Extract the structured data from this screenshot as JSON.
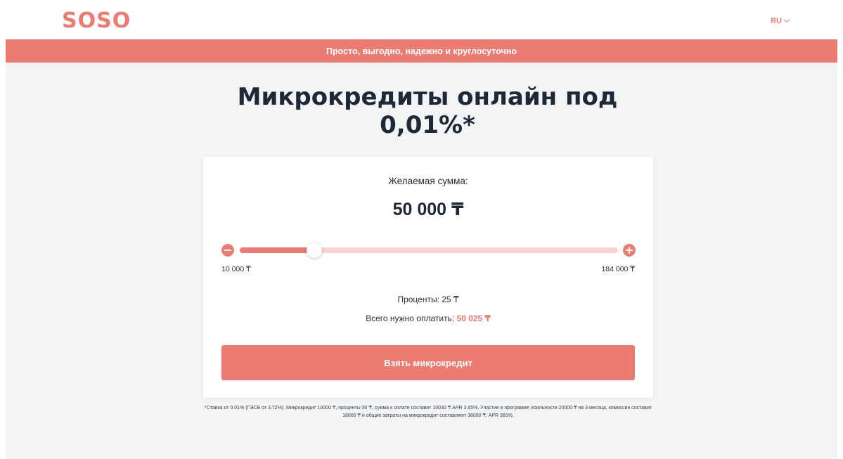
{
  "header": {
    "logo": "SOSO",
    "language": "RU"
  },
  "banner": {
    "text": "Просто, выгодно, надежно и круглосуточно"
  },
  "hero": {
    "title": "Микрокредиты онлайн под 0,01%*"
  },
  "calculator": {
    "amount_label": "Желаемая сумма:",
    "amount_value": "50 000 ₸",
    "slider": {
      "min_label": "10 000 ₸",
      "max_label": "184 000 ₸",
      "min": 10000,
      "max": 184000,
      "value": 50000
    },
    "interest_text": "Проценты: 25 ₸",
    "total_label": "Всего нужно оплатить:",
    "total_value": "50 025 ₸",
    "submit_label": "Взять микрокредит"
  },
  "disclaimer": "*Ставка от 0.01% (ГЭСВ от 3,72%). Микрокредит 10000 ₸, проценты 30 ₸, сумма к оплате составит 10030 ₸ APR 3.65%. Участие в программе лояльности 20000 ₸ на 3 месяца, комиссия составит 18000 ₸ и общие затраты на микрокредит составляют 38000 ₸, APR 365%.",
  "colors": {
    "accent": "#ec7b72",
    "accent_light": "#f8d3cf",
    "page_bg": "#f3f4f6",
    "title": "#1e2836"
  },
  "icons": {
    "minus": "minus-circle-icon",
    "plus": "plus-circle-icon",
    "lang_chevron": "chevron-down-icon"
  }
}
